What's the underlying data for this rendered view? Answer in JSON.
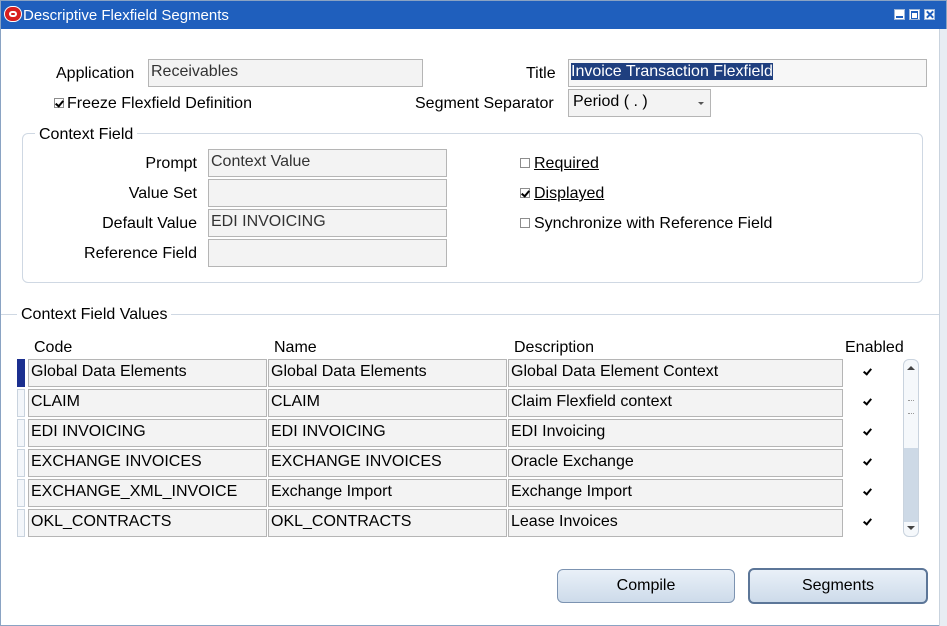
{
  "window": {
    "title": "Descriptive Flexfield Segments",
    "controls": [
      "minimize",
      "maximize",
      "close"
    ]
  },
  "header": {
    "application_label": "Application",
    "application_value": "Receivables",
    "title_label": "Title",
    "title_value": "Invoice Transaction Flexfield",
    "freeze_label_pre": "Freeze Flexfield Definition",
    "freeze_checked": true,
    "separator_label": "Segment Separator",
    "separator_value": "Period ( . )"
  },
  "context_field": {
    "group_title": "Context Field",
    "prompt_label": "Prompt",
    "prompt_value": "Context Value",
    "value_set_label": "Value Set",
    "value_set_value": "",
    "default_value_label": "Default Value",
    "default_value_value": "EDI INVOICING",
    "reference_field_label": "Reference Field",
    "reference_field_value": "",
    "required_label": "Required",
    "required_checked": false,
    "displayed_label": "Displayed",
    "displayed_checked": true,
    "sync_label": "Synchronize with Reference Field",
    "sync_checked": false
  },
  "values_table": {
    "section_title": "Context Field Values",
    "columns": [
      "Code",
      "Name",
      "Description",
      "Enabled"
    ],
    "rows": [
      {
        "code": "Global Data Elements",
        "name": "Global Data Elements",
        "description": "Global Data Element Context",
        "enabled": true
      },
      {
        "code": "CLAIM",
        "name": "CLAIM",
        "description": "Claim Flexfield context",
        "enabled": true
      },
      {
        "code": "EDI INVOICING",
        "name": "EDI INVOICING",
        "description": "EDI Invoicing",
        "enabled": true
      },
      {
        "code": "EXCHANGE INVOICES",
        "name": "EXCHANGE INVOICES",
        "description": "Oracle Exchange",
        "enabled": true
      },
      {
        "code": "EXCHANGE_XML_INVOICE",
        "name": "Exchange Import",
        "description": "Exchange Import",
        "enabled": true
      },
      {
        "code": "OKL_CONTRACTS",
        "name": "OKL_CONTRACTS",
        "description": "Lease Invoices",
        "enabled": true
      }
    ]
  },
  "buttons": {
    "compile_label": "Compile",
    "segments_label": "Segments"
  },
  "colors": {
    "titlebar": "#1f5fbd",
    "row_indicator_current": "#1b2f8f",
    "field_bg": "#f3f3f3"
  }
}
